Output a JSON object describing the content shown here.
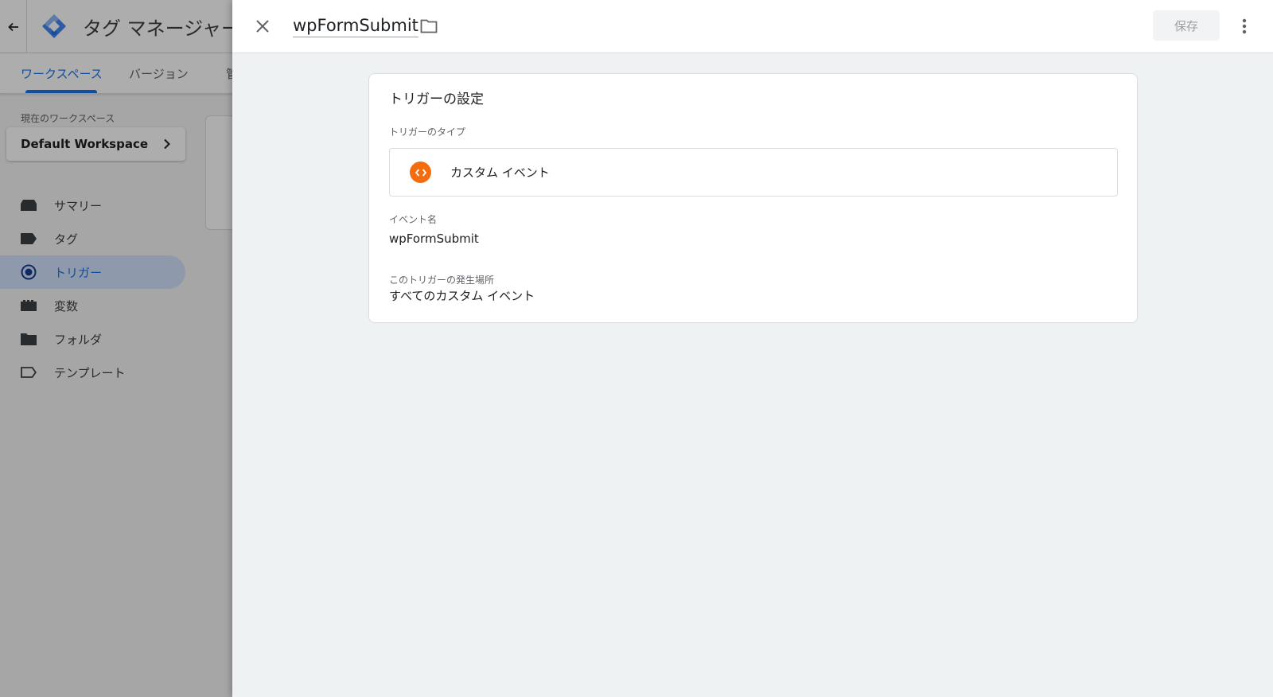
{
  "app": {
    "title": "タグ マネージャー",
    "tabs": [
      {
        "label": "ワークスペース"
      },
      {
        "label": "バージョン"
      },
      {
        "label": "管"
      }
    ]
  },
  "workspace": {
    "label": "現在のワークスペース",
    "name": "Default Workspace"
  },
  "sidebar": {
    "items": [
      {
        "label": "サマリー",
        "icon": "summary-icon"
      },
      {
        "label": "タグ",
        "icon": "tag-icon"
      },
      {
        "label": "トリガー",
        "icon": "trigger-icon",
        "active": true
      },
      {
        "label": "変数",
        "icon": "variables-icon"
      },
      {
        "label": "フォルダ",
        "icon": "folder-icon"
      },
      {
        "label": "テンプレート",
        "icon": "template-icon"
      }
    ]
  },
  "panel": {
    "trigger_name": "wpFormSubmit",
    "save_label": "保存",
    "card": {
      "title": "トリガーの設定",
      "type_label": "トリガーのタイプ",
      "type_name": "カスタム イベント",
      "type_icon": "custom-event-icon",
      "event_name_label": "イベント名",
      "event_name_value": "wpFormSubmit",
      "fires_on_label": "このトリガーの発生場所",
      "fires_on_value": "すべてのカスタム イベント"
    }
  },
  "colors": {
    "accent": "#1a73e8",
    "custom_event": "#f36c0d",
    "panel_bg": "#eff2f3"
  }
}
